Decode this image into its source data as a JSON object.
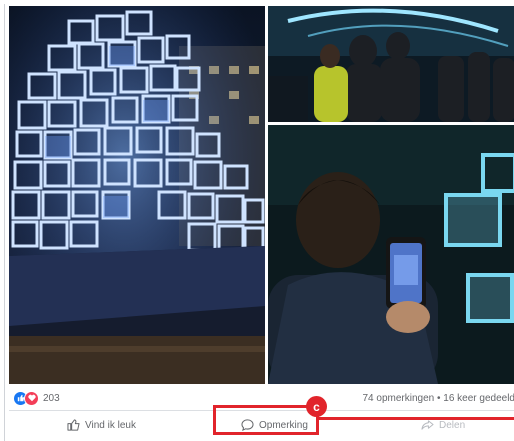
{
  "post": {
    "photos": [
      {
        "name": "light-cube-installation"
      },
      {
        "name": "crowd-under-light-art"
      },
      {
        "name": "person-filming-with-phone"
      }
    ],
    "reactions": {
      "icons": [
        "like-icon",
        "love-icon"
      ],
      "count": "203"
    },
    "stats_text": "74 opmerkingen • 16 keer gedeeld"
  },
  "actions": {
    "like_label": "Vind ik leuk",
    "comment_label": "Opmerking",
    "share_label": "Delen"
  },
  "annotation": {
    "badge": "c",
    "color": "#e1242b"
  },
  "colors": {
    "like_blue": "#1877f2",
    "love_red": "#f33e58",
    "text_gray": "#65676b"
  }
}
